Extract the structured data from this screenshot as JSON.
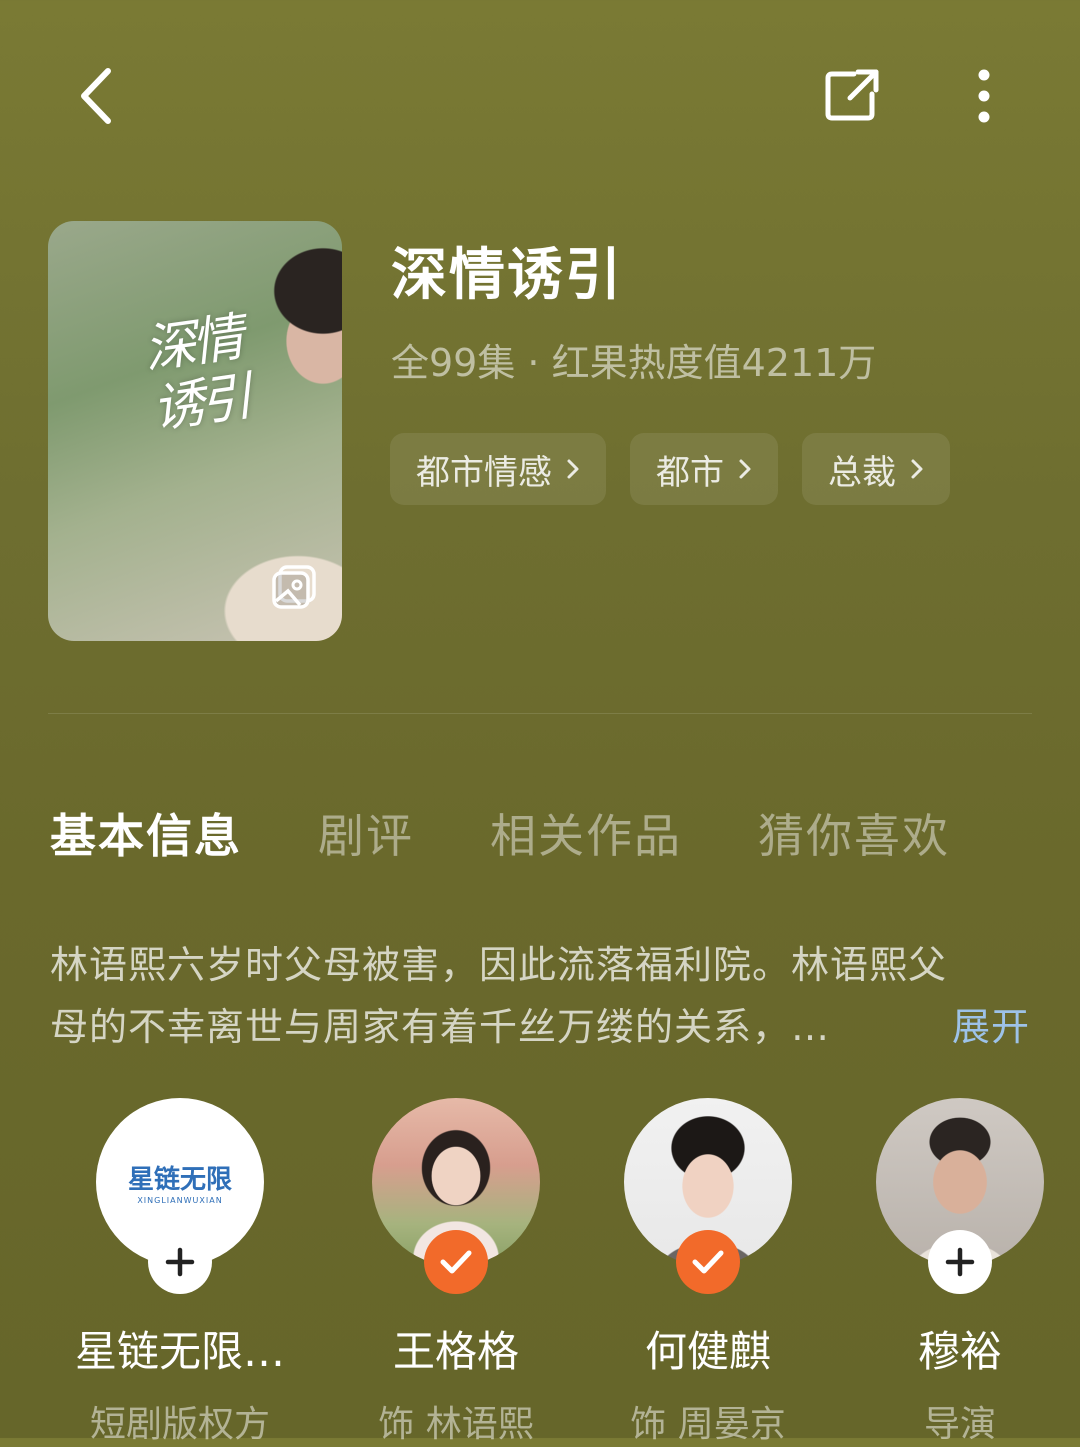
{
  "drama": {
    "title": "深情诱引",
    "meta": "全99集 · 红果热度值4211万",
    "poster_calligraphy": "深情诱引",
    "tags": [
      "都市情感",
      "都市",
      "总裁"
    ]
  },
  "tabs": [
    "基本信息",
    "剧评",
    "相关作品",
    "猜你喜欢"
  ],
  "active_tab": "基本信息",
  "synopsis": {
    "line1": "林语熙六岁时父母被害，因此流落福利院。林语熙父",
    "line2": "母的不幸离世与周家有着千丝万缕的关系，…",
    "expand_label": "展开"
  },
  "cast": [
    {
      "name": "星链无限…",
      "role": "短剧版权方",
      "badge": "plus",
      "logo_text": "星链无限",
      "logo_sub": "XINGLIANWUXIAN"
    },
    {
      "name": "王格格",
      "role": "饰 林语熙",
      "badge": "check"
    },
    {
      "name": "何健麒",
      "role": "饰 周晏京",
      "badge": "check"
    },
    {
      "name": "穆裕",
      "role": "导演",
      "badge": "plus"
    }
  ],
  "colors": {
    "accent_check": "#f26a2a",
    "expand_link": "#9dc2e8",
    "background": "#72722f"
  }
}
